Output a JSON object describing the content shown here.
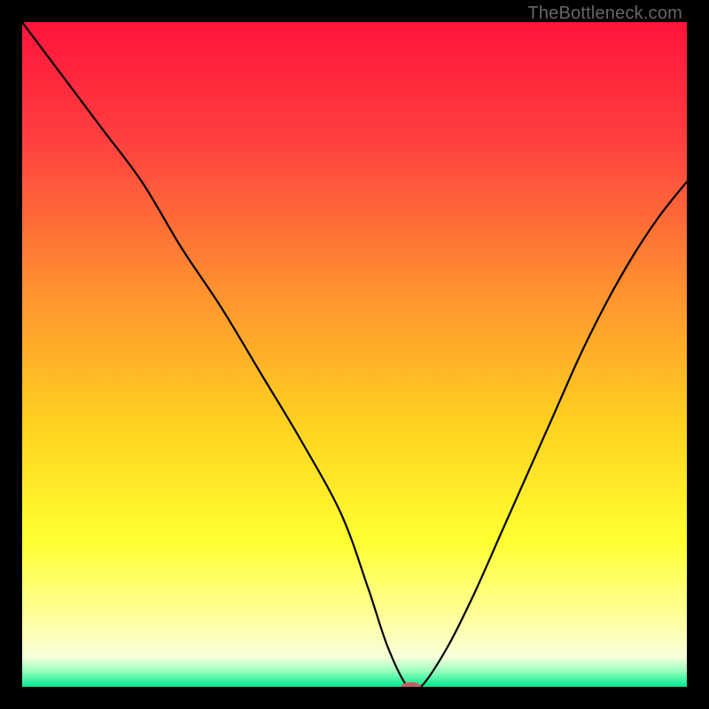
{
  "attribution": "TheBottleneck.com",
  "chart_data": {
    "type": "line",
    "title": "",
    "xlabel": "",
    "ylabel": "",
    "xlim": [
      0,
      100
    ],
    "ylim": [
      0,
      100
    ],
    "grid": false,
    "legend": false,
    "gradient_stops": [
      {
        "offset": 0.0,
        "color": "#ff143a"
      },
      {
        "offset": 0.18,
        "color": "#ff4040"
      },
      {
        "offset": 0.4,
        "color": "#ff9030"
      },
      {
        "offset": 0.6,
        "color": "#ffd020"
      },
      {
        "offset": 0.78,
        "color": "#ffff30"
      },
      {
        "offset": 0.9,
        "color": "#ffffa0"
      },
      {
        "offset": 0.955,
        "color": "#f8ffd8"
      },
      {
        "offset": 0.975,
        "color": "#a0ffc0"
      },
      {
        "offset": 1.0,
        "color": "#00e88e"
      }
    ],
    "series": [
      {
        "name": "bottleneck-curve",
        "x": [
          0,
          6,
          12,
          18,
          24,
          30,
          36,
          42,
          48,
          52,
          55,
          58,
          60,
          64,
          68,
          72,
          76,
          80,
          84,
          88,
          92,
          96,
          100
        ],
        "values": [
          100,
          92,
          84,
          76,
          66,
          57,
          47,
          37,
          26,
          15,
          6,
          0,
          0,
          6,
          14,
          23,
          32,
          41,
          50,
          58,
          65,
          71,
          76
        ]
      }
    ],
    "marker": {
      "x": 58.5,
      "y": 0,
      "rx": 1.5,
      "ry": 0.7,
      "color": "#c56060"
    }
  }
}
